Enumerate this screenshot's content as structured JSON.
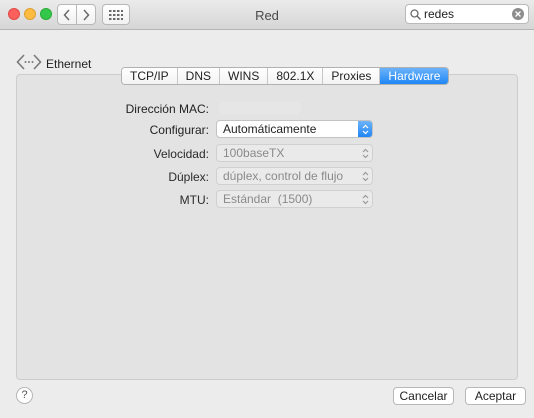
{
  "window": {
    "title": "Red",
    "search": {
      "value": "redes",
      "placeholder": ""
    }
  },
  "header": {
    "device_label": "Ethernet"
  },
  "tabs": [
    {
      "label": "TCP/IP",
      "active": false
    },
    {
      "label": "DNS",
      "active": false
    },
    {
      "label": "WINS",
      "active": false
    },
    {
      "label": "802.1X",
      "active": false
    },
    {
      "label": "Proxies",
      "active": false
    },
    {
      "label": "Hardware",
      "active": true
    }
  ],
  "form": {
    "mac": {
      "label": "Dirección MAC:"
    },
    "configure": {
      "label": "Configurar:",
      "value": "Automáticamente"
    },
    "speed": {
      "label": "Velocidad:",
      "value": "100baseTX"
    },
    "duplex": {
      "label": "Dúplex:",
      "value": "dúplex, control de flujo"
    },
    "mtu": {
      "label": "MTU:",
      "value": "Estándar  (1500)"
    }
  },
  "footer": {
    "help_label": "?",
    "cancel_label": "Cancelar",
    "ok_label": "Aceptar"
  },
  "icons": {
    "back": "chevron-left-icon",
    "forward": "chevron-right-icon",
    "grid": "grid-icon",
    "search": "search-icon",
    "clear": "clear-icon",
    "ethernet": "ethernet-icon"
  },
  "colors": {
    "accent": "#1f86f5"
  }
}
